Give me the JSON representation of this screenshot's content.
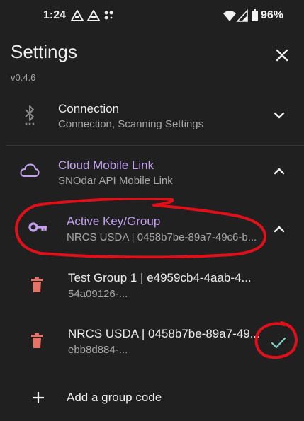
{
  "status_bar": {
    "time": "1:24",
    "battery": "96%",
    "icons": [
      "drive-icon",
      "drive-icon",
      "dots-icon",
      "wifi-icon",
      "signal-icon",
      "battery-icon"
    ]
  },
  "header": {
    "title": "Settings",
    "version": "v0.4.6",
    "close_icon": "close-icon"
  },
  "sections": [
    {
      "icon": "bluetooth-icon",
      "title": "Connection",
      "subtitle": "Connection, Scanning Settings",
      "expanded": false
    },
    {
      "icon": "cloud-icon",
      "title": "Cloud Mobile Link",
      "subtitle": "SNOdar API Mobile Link",
      "expanded": true,
      "accent": "#c4a1f0"
    }
  ],
  "active_key": {
    "icon": "key-icon",
    "title": "Active Key/Group",
    "subtitle": "NRCS USDA | 0458b7be-89a7-49c6-b...",
    "expanded": true
  },
  "groups": [
    {
      "title": "Test Group 1 | e4959cb4-4aab-4...",
      "subtitle": "54a09126-...",
      "selected": false
    },
    {
      "title": "NRCS USDA | 0458b7be-89a7-49...",
      "subtitle": "ebb8d884-...",
      "selected": true
    }
  ],
  "add_group": {
    "label": "Add a group code"
  },
  "colors": {
    "background": "#202020",
    "accent": "#c4a1f0",
    "delete": "#e57368",
    "check": "#7fd3c6",
    "annotation": "#e0101a"
  }
}
